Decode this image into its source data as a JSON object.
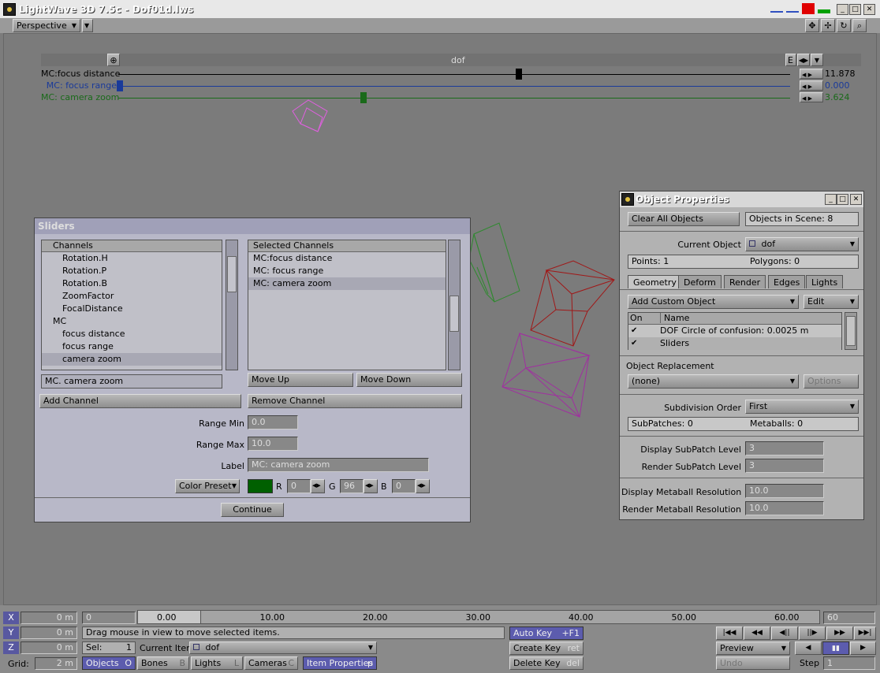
{
  "window": {
    "title": "LightWave 3D 7.5c - Dof01d.lws"
  },
  "toolbar": {
    "view_mode": "Perspective"
  },
  "mc_panel": {
    "title": "dof",
    "edit_label": "E",
    "channels": [
      {
        "label": "MC:focus distance",
        "value": "11.878",
        "color": "#000000",
        "thumb_pos": 0.59
      },
      {
        "label": "MC: focus range",
        "value": "0.000",
        "color": "#1a3a9a",
        "thumb_pos": 0.0
      },
      {
        "label": "MC: camera zoom",
        "value": "3.624",
        "color": "#1a6a1a",
        "thumb_pos": 0.36
      }
    ]
  },
  "sliders": {
    "title": "Sliders",
    "channels_header": "Channels",
    "channels": [
      "Rotation.H",
      "Rotation.P",
      "Rotation.B",
      "ZoomFactor",
      "FocalDistance",
      "MC",
      "focus distance",
      "focus range",
      "camera zoom"
    ],
    "selected_header": "Selected Channels",
    "selected": [
      "MC:focus distance",
      "MC: focus range",
      "MC: camera zoom"
    ],
    "current_channel": "MC. camera zoom",
    "move_up": "Move Up",
    "move_down": "Move Down",
    "add_channel": "Add Channel",
    "remove_channel": "Remove Channel",
    "range_min_label": "Range Min",
    "range_min": "0.0",
    "range_max_label": "Range Max",
    "range_max": "10.0",
    "label_label": "Label",
    "label_value": "MC: camera zoom",
    "color_preset": "Color Preset",
    "r_label": "R",
    "r": "0",
    "g_label": "G",
    "g": "96",
    "b_label": "B",
    "b": "0",
    "swatch_color": "#006000",
    "continue": "Continue"
  },
  "object_properties": {
    "title": "Object Properties",
    "clear_all": "Clear All Objects",
    "objects_in_scene": "Objects in Scene: 8",
    "current_object_label": "Current Object",
    "current_object": "dof",
    "points": "Points: 1",
    "polygons": "Polygons: 0",
    "tabs": [
      "Geometry",
      "Deform",
      "Render",
      "Edges",
      "Lights"
    ],
    "add_custom": "Add Custom Object",
    "edit": "Edit",
    "col_on": "On",
    "col_name": "Name",
    "custom_objects": [
      "DOF Circle of confusion: 0.0025 m",
      "Sliders"
    ],
    "replacement_label": "Object Replacement",
    "replacement": "(none)",
    "options": "Options",
    "subdiv_label": "Subdivision Order",
    "subdiv": "First",
    "subpatches": "SubPatches: 0",
    "metaballs": "Metaballs: 0",
    "disp_subpatch_label": "Display SubPatch Level",
    "disp_subpatch": "3",
    "rend_subpatch_label": "Render SubPatch Level",
    "rend_subpatch": "3",
    "disp_meta_label": "Display Metaball Resolution",
    "disp_meta": "10.0",
    "rend_meta_label": "Render Metaball Resolution",
    "rend_meta": "10.0"
  },
  "bottom": {
    "x_label": "X",
    "x_val": "0 m",
    "y_label": "Y",
    "y_val": "0 m",
    "z_label": "Z",
    "z_val": "0 m",
    "grid_label": "Grid:",
    "grid_val": "2 m",
    "frame_start": "0",
    "ruler": [
      "0.00",
      "10.00",
      "20.00",
      "30.00",
      "40.00",
      "50.00",
      "60.00"
    ],
    "frame_end": "60",
    "status": "Drag mouse in view to move selected items.",
    "sel_label": "Sel:",
    "sel_val": "1",
    "current_item_label": "Current Item",
    "current_item": "dof",
    "modes": [
      {
        "label": "Objects",
        "key": "O"
      },
      {
        "label": "Bones",
        "key": "B"
      },
      {
        "label": "Lights",
        "key": "L"
      },
      {
        "label": "Cameras",
        "key": "C"
      }
    ],
    "item_properties": "Item Properties",
    "item_properties_key": "p",
    "auto_key": "Auto Key",
    "auto_key_key": "+F1",
    "create_key": "Create Key",
    "create_key_key": "ret",
    "delete_key": "Delete Key",
    "delete_key_key": "del",
    "preview": "Preview",
    "undo": "Undo",
    "step_label": "Step",
    "step_val": "1"
  }
}
